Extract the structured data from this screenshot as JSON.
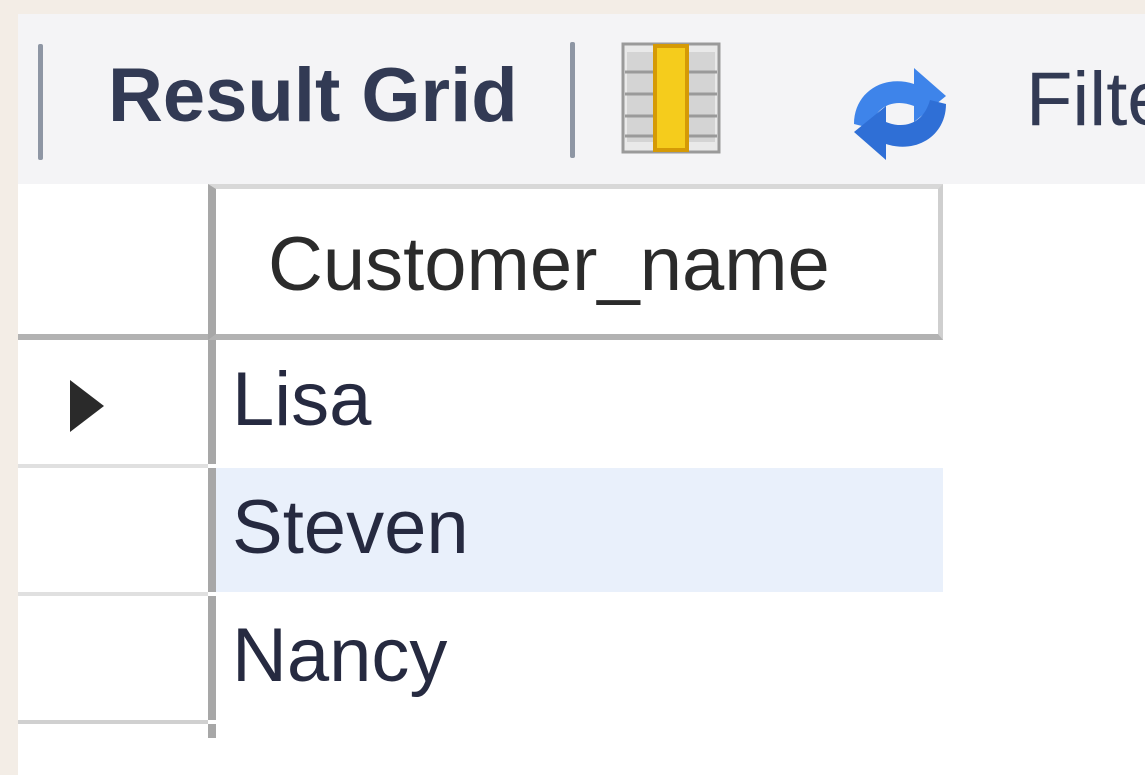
{
  "toolbar": {
    "result_grid_label": "Result Grid",
    "filter_label": "Filte",
    "icons": {
      "grid_view": "grid-view-icon",
      "refresh": "refresh-icon"
    }
  },
  "grid": {
    "columns": [
      {
        "header": "Customer_name"
      }
    ],
    "rows": [
      {
        "customer_name": "Lisa",
        "current": true,
        "selected": false
      },
      {
        "customer_name": "Steven",
        "current": false,
        "selected": true
      },
      {
        "customer_name": "Nancy",
        "current": false,
        "selected": false
      }
    ]
  },
  "colors": {
    "selected_row": "#e9f0fb",
    "toolbar_bg": "#f4f4f6",
    "icon_yellow": "#f5cc1c",
    "icon_blue": "#3e84ea"
  }
}
